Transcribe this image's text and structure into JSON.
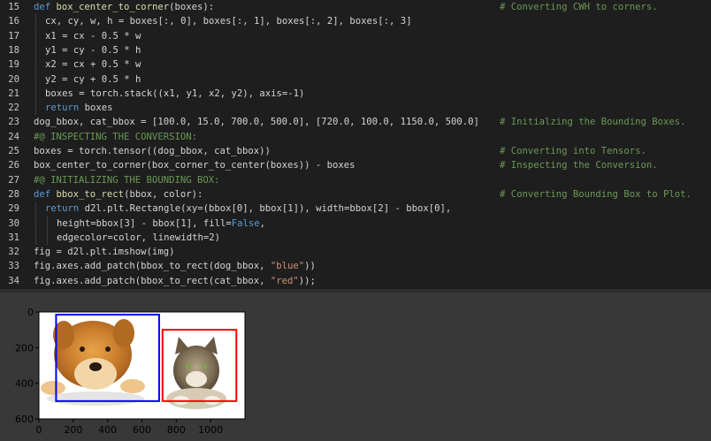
{
  "editor": {
    "lines": [
      {
        "n": "15",
        "segs": [
          {
            "t": "def ",
            "c": "kw"
          },
          {
            "t": "box_center_to_corner",
            "c": "fn"
          },
          {
            "t": "(boxes):",
            "c": ""
          }
        ],
        "comment": "# Converting CWH to corners.",
        "indent": 0
      },
      {
        "n": "16",
        "segs": [
          {
            "t": "cx, cy, w, h = boxes[:, 0], boxes[:, 1], boxes[:, 2], boxes[:, 3]",
            "c": ""
          }
        ],
        "comment": "",
        "indent": 1
      },
      {
        "n": "17",
        "segs": [
          {
            "t": "x1 = cx - 0.5 * w",
            "c": ""
          }
        ],
        "comment": "",
        "indent": 1
      },
      {
        "n": "18",
        "segs": [
          {
            "t": "y1 = cy - 0.5 * h",
            "c": ""
          }
        ],
        "comment": "",
        "indent": 1
      },
      {
        "n": "19",
        "segs": [
          {
            "t": "x2 = cx + 0.5 * w",
            "c": ""
          }
        ],
        "comment": "",
        "indent": 1
      },
      {
        "n": "20",
        "segs": [
          {
            "t": "y2 = cy + 0.5 * h",
            "c": ""
          }
        ],
        "comment": "",
        "indent": 1
      },
      {
        "n": "21",
        "segs": [
          {
            "t": "boxes = torch.stack((x1, y1, x2, y2), axis=-1)",
            "c": ""
          }
        ],
        "comment": "",
        "indent": 1
      },
      {
        "n": "22",
        "segs": [
          {
            "t": "return",
            "c": "kw"
          },
          {
            "t": " boxes",
            "c": ""
          }
        ],
        "comment": "",
        "indent": 1
      },
      {
        "n": "23",
        "segs": [
          {
            "t": "dog_bbox, cat_bbox = [100.0, 15.0, 700.0, 500.0], [720.0, 100.0, 1150.0, 500.0]",
            "c": ""
          }
        ],
        "comment": "# Initialzing the Bounding Boxes.",
        "indent": 0
      },
      {
        "n": "24",
        "segs": [
          {
            "t": "#@ INSPECTING THE CONVERSION:",
            "c": "cmt"
          }
        ],
        "comment": "",
        "indent": 0
      },
      {
        "n": "25",
        "segs": [
          {
            "t": "boxes = torch.tensor((dog_bbox, cat_bbox))",
            "c": ""
          }
        ],
        "comment": "# Converting into Tensors.",
        "indent": 0
      },
      {
        "n": "26",
        "segs": [
          {
            "t": "box_center_to_corner(box_corner_to_center(boxes)) - boxes",
            "c": ""
          }
        ],
        "comment": "# Inspecting the Conversion.",
        "indent": 0
      },
      {
        "n": "27",
        "segs": [
          {
            "t": "#@ INITIALIZING THE BOUNDING BOX:",
            "c": "cmt"
          }
        ],
        "comment": "",
        "indent": 0
      },
      {
        "n": "28",
        "segs": [
          {
            "t": "def ",
            "c": "kw"
          },
          {
            "t": "bbox_to_rect",
            "c": "fn"
          },
          {
            "t": "(bbox, color):",
            "c": ""
          }
        ],
        "comment": "# Converting Bounding Box to Plot.",
        "indent": 0
      },
      {
        "n": "29",
        "segs": [
          {
            "t": "return",
            "c": "kw"
          },
          {
            "t": " d2l.plt.Rectangle(xy=(bbox[0], bbox[1]), width=bbox[2] - bbox[0],",
            "c": ""
          }
        ],
        "comment": "",
        "indent": 1
      },
      {
        "n": "30",
        "segs": [
          {
            "t": "height=bbox[3] - bbox[1], fill=",
            "c": ""
          },
          {
            "t": "False",
            "c": "kw"
          },
          {
            "t": ",",
            "c": ""
          }
        ],
        "comment": "",
        "indent": 2
      },
      {
        "n": "31",
        "segs": [
          {
            "t": "edgecolor=color, linewidth=2)",
            "c": ""
          }
        ],
        "comment": "",
        "indent": 2
      },
      {
        "n": "32",
        "segs": [
          {
            "t": "fig = d2l.plt.imshow(img)",
            "c": ""
          }
        ],
        "comment": "",
        "indent": 0
      },
      {
        "n": "33",
        "segs": [
          {
            "t": "fig.axes.add_patch(bbox_to_rect(dog_bbox, ",
            "c": ""
          },
          {
            "t": "\"blue\"",
            "c": "str"
          },
          {
            "t": "))",
            "c": ""
          }
        ],
        "comment": "",
        "indent": 0
      },
      {
        "n": "34",
        "segs": [
          {
            "t": "fig.axes.add_patch(bbox_to_rect(cat_bbox, ",
            "c": ""
          },
          {
            "t": "\"red\"",
            "c": "str"
          },
          {
            "t": "));",
            "c": ""
          }
        ],
        "comment": "",
        "indent": 0
      }
    ]
  },
  "plot": {
    "yticks": [
      "0",
      "200",
      "400",
      "600"
    ],
    "xticks": [
      "0",
      "200",
      "400",
      "600",
      "800",
      "1000"
    ],
    "image_extent": {
      "width": 1200,
      "height": 600
    },
    "boxes": [
      {
        "name": "dog",
        "xyxy": [
          100,
          15,
          700,
          500
        ],
        "color": "#0000ff"
      },
      {
        "name": "cat",
        "xyxy": [
          720,
          100,
          1150,
          500
        ],
        "color": "#ff0000"
      }
    ]
  }
}
